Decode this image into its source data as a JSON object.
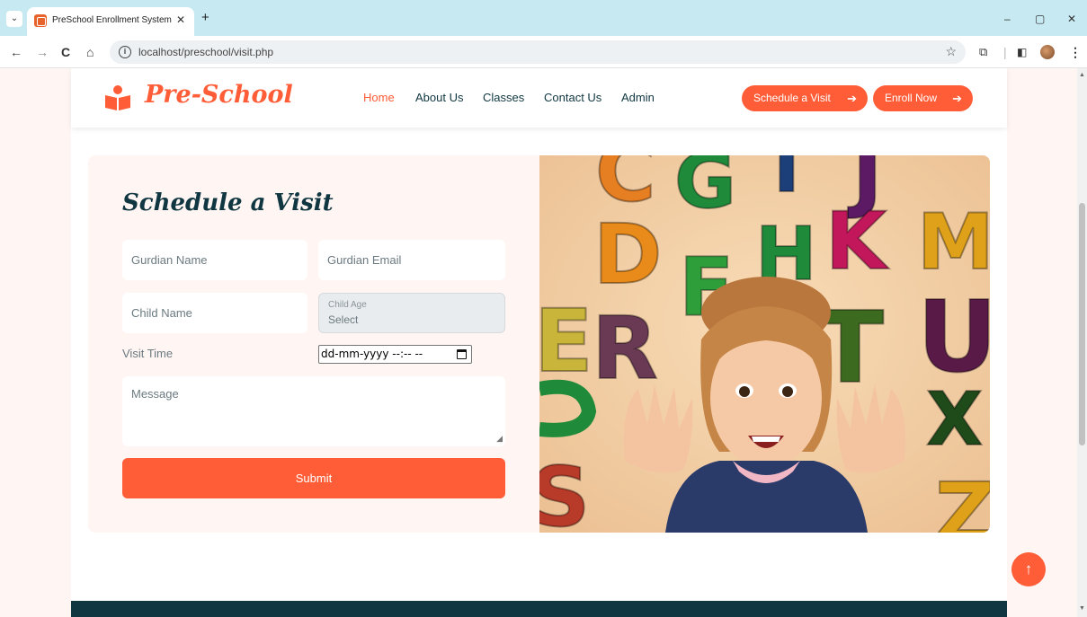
{
  "browser": {
    "tab_title": "PreSchool Enrollment System",
    "tab_close": "✕",
    "new_tab": "+",
    "url": "localhost/preschool/visit.php",
    "minimize": "–",
    "restore": "▢",
    "close": "✕"
  },
  "navbar": {
    "logo_text": "Pre-School",
    "links": [
      "Home",
      "About Us",
      "Classes",
      "Contact Us",
      "Admin"
    ],
    "active_link": "Home",
    "schedule_button": "Schedule a Visit",
    "enroll_button": "Enroll Now"
  },
  "form": {
    "heading": "Schedule a Visit",
    "guardian_name_placeholder": "Gurdian Name",
    "guardian_email_placeholder": "Gurdian Email",
    "child_name_placeholder": "Child Name",
    "child_age_label": "Child Age",
    "child_age_value": "Select",
    "visit_time_label": "Visit Time",
    "visit_time_value": "dd-mm-yyyy --:-- --",
    "message_placeholder": "Message",
    "submit_label": "Submit"
  },
  "image_letters": [
    "C",
    "G",
    "I",
    "J",
    "D",
    "H",
    "K",
    "M",
    "F",
    "E",
    "R",
    "T",
    "U",
    "X",
    "S",
    "Z"
  ],
  "colors": {
    "accent": "#fe5d37",
    "dark": "#103741",
    "card_bg": "#fff5f3",
    "page_bg": "#fff6f3"
  },
  "icons": {
    "back_to_top": "arrow-up-icon"
  }
}
